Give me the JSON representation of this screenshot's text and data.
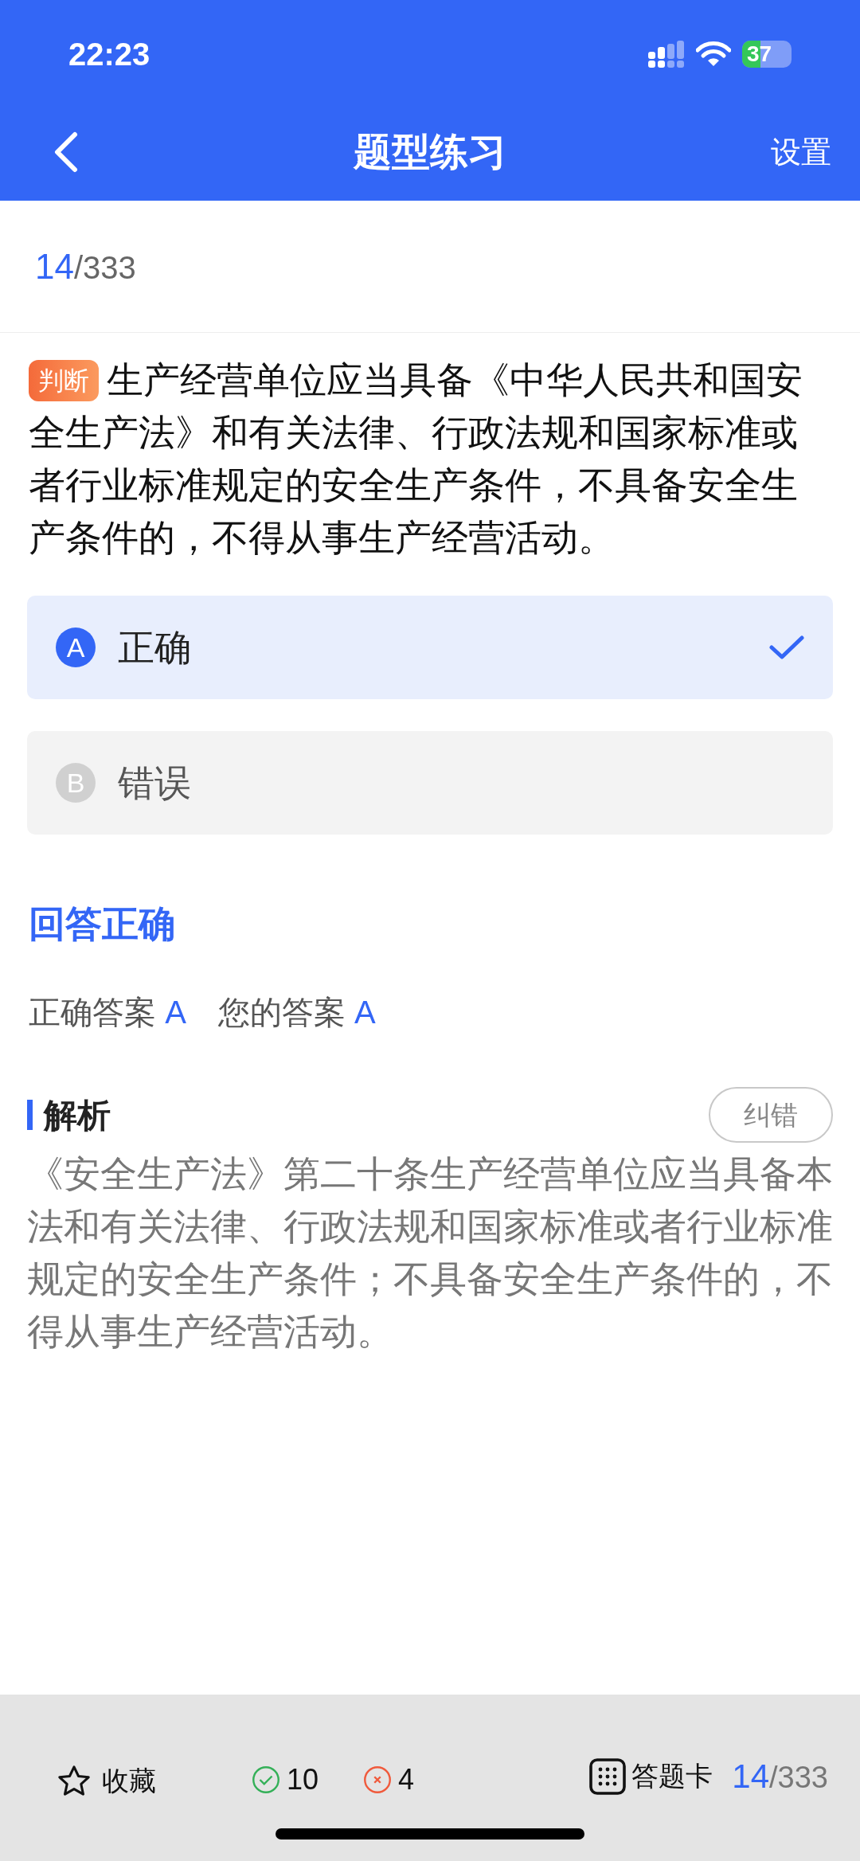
{
  "status_bar": {
    "time": "22:23",
    "battery": "37"
  },
  "nav": {
    "title": "题型练习",
    "action": "设置"
  },
  "progress": {
    "current": "14",
    "total": "/333"
  },
  "question": {
    "tag": "判断",
    "text": "生产经营单位应当具备《中华人民共和国安全生产法》和有关法律、行政法规和国家标准或者行业标准规定的安全生产条件，不具备安全生产条件的，不得从事生产经营活动。"
  },
  "options": [
    {
      "letter": "A",
      "text": "正确",
      "selected": true
    },
    {
      "letter": "B",
      "text": "错误",
      "selected": false
    }
  ],
  "result": {
    "title": "回答正确",
    "correct_label": "正确答案",
    "correct_value": "A",
    "your_label": "您的答案",
    "your_value": "A"
  },
  "analysis": {
    "title": "解析",
    "report_button": "纠错",
    "text": "《安全生产法》第二十条生产经营单位应当具备本法和有关法律、行政法规和国家标准或者行业标准规定的安全生产条件；不具备安全生产条件的，不得从事生产经营活动。"
  },
  "bottom_bar": {
    "favorite": "收藏",
    "correct_count": "10",
    "wrong_count": "4",
    "answer_card": "答题卡",
    "current": "14",
    "total": "/333"
  }
}
